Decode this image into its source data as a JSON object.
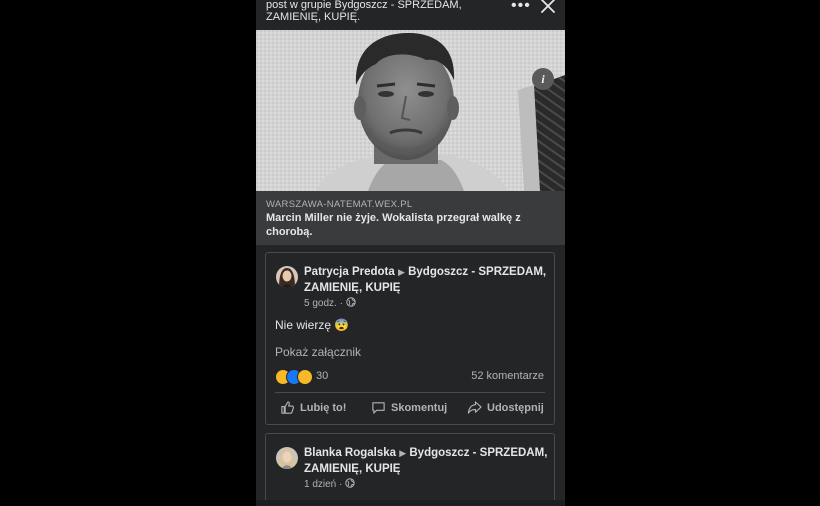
{
  "header": {
    "line1": "post w grupie Bydgoszcz - SPRZEDAM,",
    "line2": "ZAMIENIĘ, KUPIĘ.",
    "more_icon": "more-horizontal-icon",
    "close_icon": "close-icon"
  },
  "link_preview": {
    "domain": "WARSZAWA-NATEMAT.WEX.PL",
    "title": "Marcin Miller nie żyje. Wokalista przegrał walkę z chorobą."
  },
  "post1": {
    "author": "Patrycja Predota",
    "arrow": "▶",
    "group": "Bydgoszcz - SPRZEDAM, ZAMIENIĘ, KUPIĘ",
    "time": "5 godz. ·",
    "message": "Nie wierzę 😨",
    "attachment": "Pokaż załącznik",
    "reaction_count": "30",
    "comments": "52 komentarze",
    "like": "Lubię to!",
    "comment": "Skomentuj",
    "share": "Udostępnij"
  },
  "post2": {
    "author": "Blanka Rogalska",
    "arrow": "▶",
    "group": "Bydgoszcz - SPRZEDAM, ZAMIENIĘ, KUPIĘ",
    "time": "1 dzień ·"
  },
  "colors": {
    "background": "#242526",
    "card": "#242526",
    "link_box": "#3a3b3c",
    "text": "#e4e6eb",
    "secondary_text": "#b0b3b8"
  }
}
